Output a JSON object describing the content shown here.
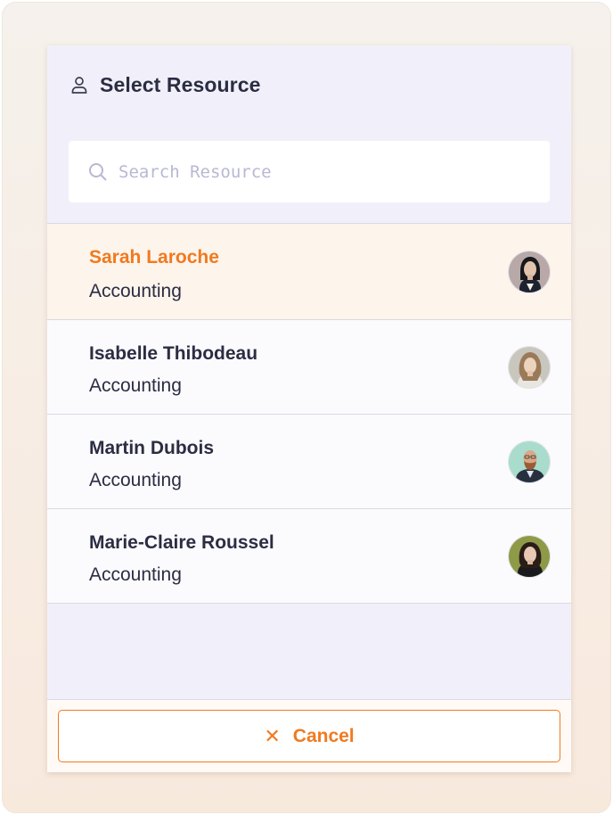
{
  "dialog": {
    "title": "Select Resource",
    "title_icon": "user-icon"
  },
  "search": {
    "placeholder": "Search Resource",
    "value": "",
    "icon": "search-icon"
  },
  "resources": [
    {
      "name": "Sarah Laroche",
      "department": "Accounting",
      "selected": true,
      "avatar": "avatar-photo"
    },
    {
      "name": "Isabelle Thibodeau",
      "department": "Accounting",
      "selected": false,
      "avatar": "avatar-photo"
    },
    {
      "name": "Martin Dubois",
      "department": "Accounting",
      "selected": false,
      "avatar": "avatar-photo"
    },
    {
      "name": "Marie-Claire Roussel",
      "department": "Accounting",
      "selected": false,
      "avatar": "avatar-photo"
    }
  ],
  "footer": {
    "cancel_label": "Cancel",
    "cancel_icon": "close-icon"
  },
  "colors": {
    "accent": "#f07a20",
    "text": "#2b2d42",
    "panel_bg": "#f1f0fa",
    "selected_row_bg": "#fdf4ec",
    "placeholder": "#b8b8d4"
  }
}
